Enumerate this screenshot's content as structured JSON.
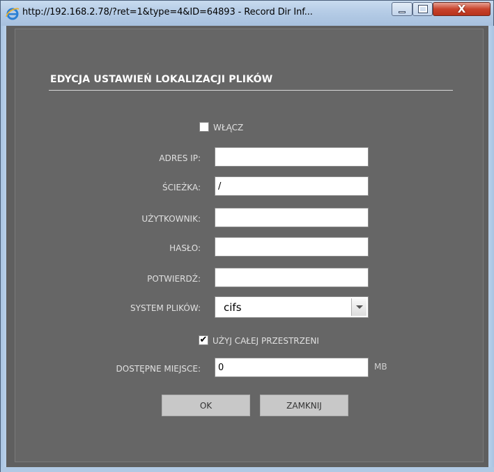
{
  "window": {
    "title": "http://192.168.2.78/?ret=1&type=4&ID=64893 - Record Dir Inf...",
    "close_glyph": "X"
  },
  "form": {
    "heading": "EDYCJA USTAWIEŃ LOKALIZACJI PLIKÓW",
    "enable_label": "WŁĄCZ",
    "enable_checked": false,
    "ip_label": "ADRES IP:",
    "ip_value": "",
    "path_label": "ŚCIEŻKA:",
    "path_value": "/",
    "user_label": "UŻYTKOWNIK:",
    "user_value": "",
    "password_label": "HASŁO:",
    "password_value": "",
    "confirm_label": "POTWIERDŹ:",
    "confirm_value": "",
    "fs_label": "SYSTEM PLIKÓW:",
    "fs_value": "cifs",
    "use_all_label": "UŻYJ CAŁEJ PRZESTRZENI",
    "use_all_checked": true,
    "check_glyph": "✔",
    "space_label": "DOSTĘPNE MIEJSCE:",
    "space_value": "0",
    "space_unit": "MB",
    "ok_label": "OK",
    "close_label": "ZAMKNIJ"
  }
}
